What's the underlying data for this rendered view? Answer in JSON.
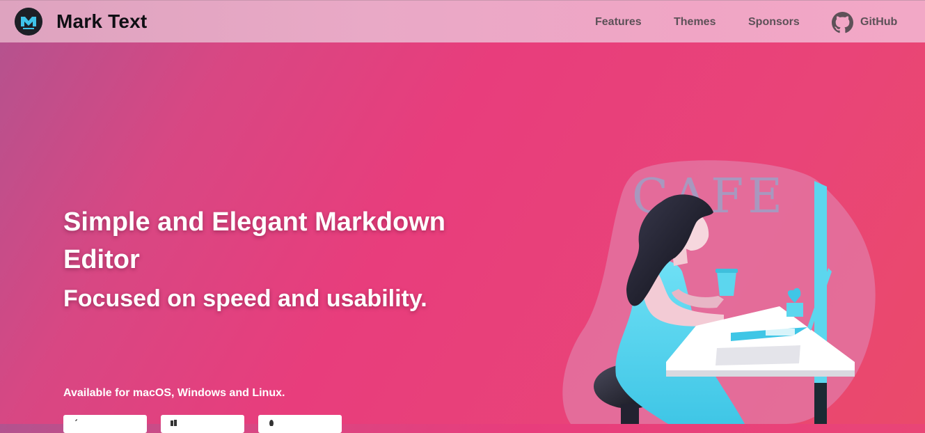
{
  "header": {
    "brand": "Mark Text",
    "nav": [
      {
        "label": "Features"
      },
      {
        "label": "Themes"
      },
      {
        "label": "Sponsors"
      },
      {
        "label": "GitHub"
      }
    ]
  },
  "hero": {
    "title": "Simple and Elegant Markdown Editor",
    "subtitle": "Focused on speed and usability.",
    "availability": "Available for macOS, Windows and Linux.",
    "illustration_text": "CAFE",
    "download_buttons": [
      {
        "icon": "apple-icon"
      },
      {
        "icon": "windows-icon"
      },
      {
        "icon": "linux-icon"
      }
    ]
  },
  "colors": {
    "accent": "#e83d7c",
    "topbar": "#f0a5c5",
    "illustration_cyan": "#5cd6ee"
  }
}
